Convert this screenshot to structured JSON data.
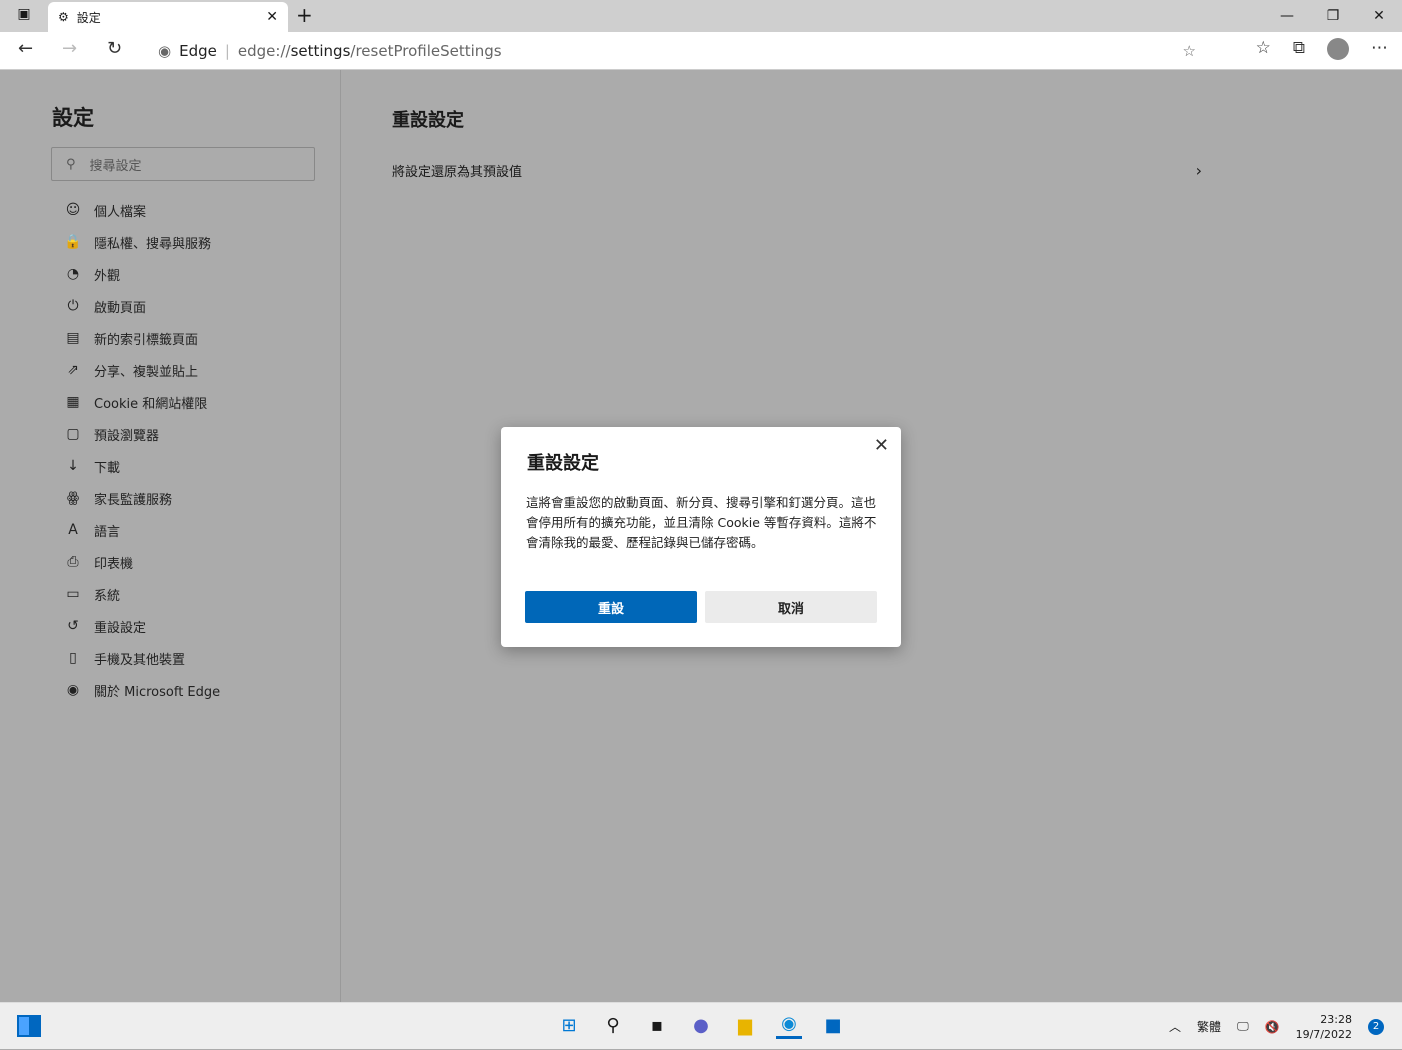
{
  "browser": {
    "tab_title": "設定",
    "address_host": "Edge",
    "address_url_prefix": "edge://",
    "address_url_bold": "settings",
    "address_url_rest": "/resetProfileSettings"
  },
  "sidebar": {
    "title": "設定",
    "search_placeholder": "搜尋設定",
    "items": [
      {
        "label": "個人檔案",
        "icon": "profile-icon"
      },
      {
        "label": "隱私權、搜尋與服務",
        "icon": "lock-icon"
      },
      {
        "label": "外觀",
        "icon": "palette-icon"
      },
      {
        "label": "啟動頁面",
        "icon": "power-icon"
      },
      {
        "label": "新的索引標籤頁面",
        "icon": "newtab-icon"
      },
      {
        "label": "分享、複製並貼上",
        "icon": "share-icon"
      },
      {
        "label": "Cookie 和網站權限",
        "icon": "cookie-icon"
      },
      {
        "label": "預設瀏覽器",
        "icon": "browser-icon"
      },
      {
        "label": "下載",
        "icon": "download-icon"
      },
      {
        "label": "家長監護服務",
        "icon": "family-icon"
      },
      {
        "label": "語言",
        "icon": "language-icon"
      },
      {
        "label": "印表機",
        "icon": "printer-icon"
      },
      {
        "label": "系統",
        "icon": "laptop-icon"
      },
      {
        "label": "重設設定",
        "icon": "reset-icon"
      },
      {
        "label": "手機及其他裝置",
        "icon": "phone-icon"
      },
      {
        "label": "關於 Microsoft Edge",
        "icon": "edge-icon"
      }
    ]
  },
  "main": {
    "title": "重設設定",
    "row_label": "將設定還原為其預設值"
  },
  "dialog": {
    "title": "重設設定",
    "body": "這將會重設您的啟動頁面、新分頁、搜尋引擎和釘選分頁。這也會停用所有的擴充功能，並且清除 Cookie 等暫存資料。這將不會清除我的最愛、歷程記錄與已儲存密碼。",
    "confirm": "重設",
    "cancel": "取消"
  },
  "taskbar": {
    "ime": "繁體",
    "time": "23:28",
    "date": "19/7/2022",
    "notifications": "2"
  }
}
